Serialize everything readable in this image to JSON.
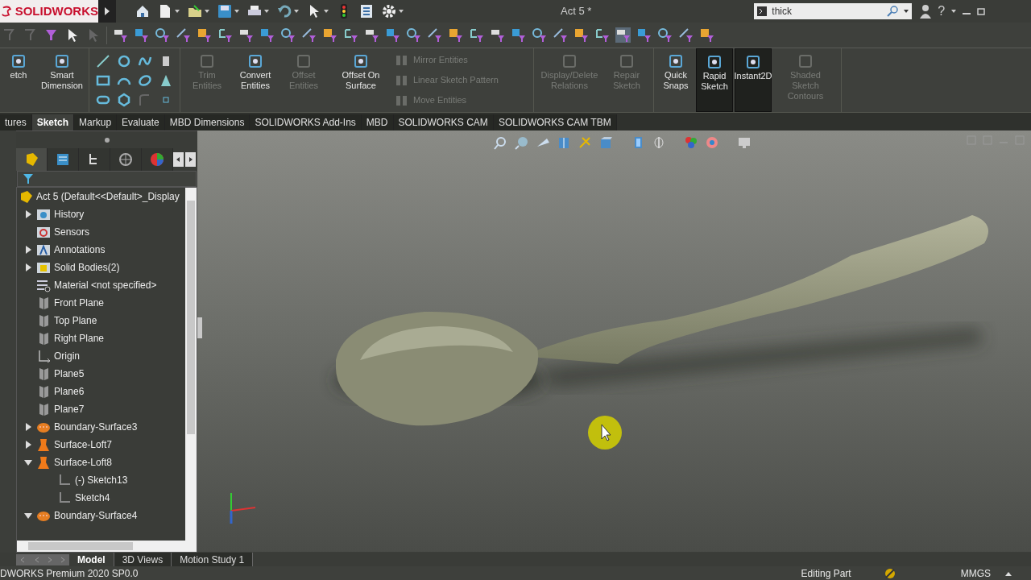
{
  "app": {
    "logo": "SOLIDWORKS",
    "title": "Act 5 *"
  },
  "search": {
    "value": "thick"
  },
  "help": "?",
  "panel_tabs": [
    {
      "selected": true
    },
    {
      "selected": false
    },
    {
      "selected": false
    },
    {
      "selected": false
    },
    {
      "selected": false
    }
  ],
  "ribbon": {
    "sections": [
      {
        "buttons": [
          {
            "kind": "big",
            "label": "etch",
            "disabled": false,
            "active": false
          },
          {
            "kind": "big",
            "label": "Smart Dimension",
            "disabled": false,
            "active": false
          }
        ]
      },
      {
        "buttons": [
          {
            "kind": "tools"
          }
        ]
      },
      {
        "buttons": [
          {
            "kind": "big",
            "label": "Trim Entities",
            "disabled": true,
            "active": false
          },
          {
            "kind": "big",
            "label": "Convert Entities",
            "disabled": false,
            "active": false
          },
          {
            "kind": "big",
            "label": "Offset Entities",
            "disabled": true,
            "active": false
          },
          {
            "kind": "big",
            "label": "Offset On Surface",
            "disabled": false,
            "active": false
          },
          {
            "kind": "small",
            "label": "Mirror Entities",
            "disabled": true
          },
          {
            "kind": "small",
            "label": "Linear Sketch Pattern",
            "disabled": true
          },
          {
            "kind": "small",
            "label": "Move Entities",
            "disabled": true
          }
        ]
      },
      {
        "buttons": [
          {
            "kind": "big",
            "label": "Display/Delete Relations",
            "disabled": true,
            "active": false
          },
          {
            "kind": "big",
            "label": "Repair Sketch",
            "disabled": true,
            "active": false
          }
        ]
      },
      {
        "buttons": [
          {
            "kind": "big",
            "label": "Quick Snaps",
            "disabled": false,
            "active": false
          },
          {
            "kind": "big",
            "label": "Rapid Sketch",
            "disabled": false,
            "active": true
          },
          {
            "kind": "big",
            "label": "Instant2D",
            "disabled": false,
            "active": true
          },
          {
            "kind": "big",
            "label": "Shaded Sketch Contours",
            "disabled": true,
            "active": false
          }
        ]
      }
    ]
  },
  "tabs": [
    {
      "label": "tures",
      "selected": false
    },
    {
      "label": "Sketch",
      "selected": true
    },
    {
      "label": "Markup",
      "selected": false
    },
    {
      "label": "Evaluate",
      "selected": false
    },
    {
      "label": "MBD Dimensions",
      "selected": false
    },
    {
      "label": "SOLIDWORKS Add-Ins",
      "selected": false
    },
    {
      "label": "MBD",
      "selected": false
    },
    {
      "label": "SOLIDWORKS CAM",
      "selected": false
    },
    {
      "label": "SOLIDWORKS CAM TBM",
      "selected": false
    }
  ],
  "tree": {
    "root": "Act 5  (Default<<Default>_Display",
    "items": [
      {
        "label": "History",
        "kind": "history",
        "expanded": false
      },
      {
        "label": "Sensors",
        "kind": "sensors"
      },
      {
        "label": "Annotations",
        "kind": "annotations",
        "expanded": false
      },
      {
        "label": "Solid Bodies(2)",
        "kind": "bodies",
        "expanded": false
      },
      {
        "label": "Material <not specified>",
        "kind": "material"
      },
      {
        "label": "Front Plane",
        "kind": "plane"
      },
      {
        "label": "Top Plane",
        "kind": "plane"
      },
      {
        "label": "Right Plane",
        "kind": "plane"
      },
      {
        "label": "Origin",
        "kind": "origin"
      },
      {
        "label": "Plane5",
        "kind": "plane"
      },
      {
        "label": "Plane6",
        "kind": "plane"
      },
      {
        "label": "Plane7",
        "kind": "plane"
      },
      {
        "label": "Boundary-Surface3",
        "kind": "boundary",
        "expanded": false
      },
      {
        "label": "Surface-Loft7",
        "kind": "loft",
        "expanded": false
      },
      {
        "label": "Surface-Loft8",
        "kind": "loft",
        "expanded": true,
        "children": [
          {
            "label": "(-) Sketch13",
            "kind": "sketch"
          },
          {
            "label": "Sketch4",
            "kind": "sketch"
          }
        ]
      },
      {
        "label": "Boundary-Surface4",
        "kind": "boundary",
        "expanded": true
      }
    ]
  },
  "bottom_tabs": [
    {
      "label": "Model",
      "selected": true
    },
    {
      "label": "3D Views",
      "selected": false
    },
    {
      "label": "Motion Study 1",
      "selected": false
    }
  ],
  "status_bar": {
    "product": "DWORKS Premium 2020 SP0.0",
    "mode": "Editing Part",
    "units": "MMGS"
  }
}
